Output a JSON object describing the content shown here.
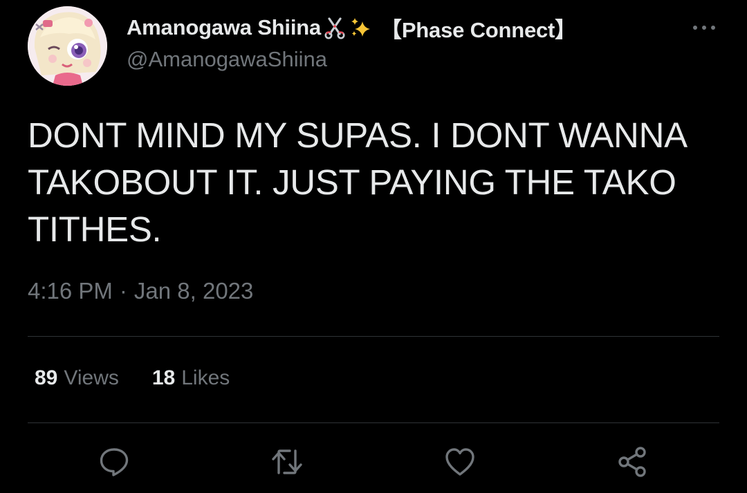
{
  "author": {
    "display_name": "Amanogawa Shiina",
    "name_emojis": [
      "scissors-icon",
      "sparkles-icon"
    ],
    "affiliation": "【Phase Connect】",
    "handle": "@AmanogawaShiina"
  },
  "tweet": {
    "text": "DONT MIND MY SUPAS. I DONT WANNA TAKOBOUT IT. JUST PAYING THE TAKO TITHES.",
    "time": "4:16 PM",
    "separator": "·",
    "date": "Jan 8, 2023"
  },
  "stats": {
    "views_count": "89",
    "views_label": "Views",
    "likes_count": "18",
    "likes_label": "Likes"
  },
  "actions": [
    "reply-icon",
    "retweet-icon",
    "like-icon",
    "share-icon"
  ],
  "colors": {
    "background": "#000000",
    "primary_text": "#e7e9ea",
    "secondary_text": "#71767b",
    "divider": "#2f3336",
    "sparkle": "#f7c536"
  }
}
